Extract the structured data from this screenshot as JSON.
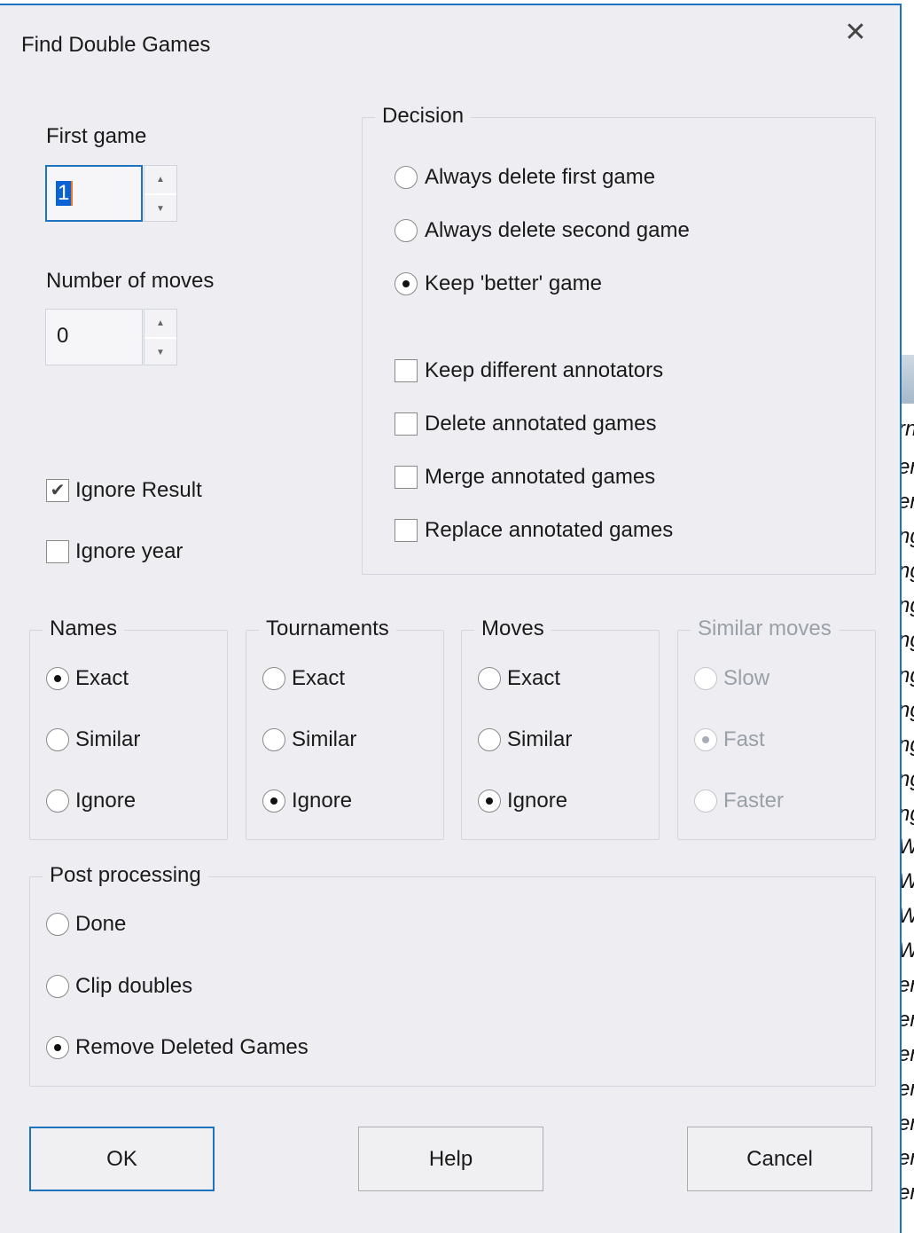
{
  "dialog": {
    "title": "Find Double Games",
    "close_icon": "close-icon"
  },
  "first_game": {
    "label": "First game",
    "value": "1"
  },
  "number_of_moves": {
    "label": "Number of moves",
    "value": "0"
  },
  "options": [
    {
      "label": "Ignore Result",
      "checked": true
    },
    {
      "label": "Ignore year",
      "checked": false
    }
  ],
  "decision": {
    "title": "Decision",
    "radios": [
      {
        "label": "Always delete first game",
        "selected": false
      },
      {
        "label": "Always delete second game",
        "selected": false
      },
      {
        "label": "Keep 'better' game",
        "selected": true
      }
    ],
    "checkboxes": [
      {
        "label": "Keep different annotators",
        "checked": false
      },
      {
        "label": "Delete annotated games",
        "checked": false
      },
      {
        "label": "Merge annotated games",
        "checked": false
      },
      {
        "label": "Replace annotated games",
        "checked": false
      }
    ]
  },
  "groups": [
    {
      "title": "Names",
      "enabled": true,
      "options": [
        {
          "label": "Exact",
          "selected": true
        },
        {
          "label": "Similar",
          "selected": false
        },
        {
          "label": "Ignore",
          "selected": false
        }
      ]
    },
    {
      "title": "Tournaments",
      "enabled": true,
      "options": [
        {
          "label": "Exact",
          "selected": false
        },
        {
          "label": "Similar",
          "selected": false
        },
        {
          "label": "Ignore",
          "selected": true
        }
      ]
    },
    {
      "title": "Moves",
      "enabled": true,
      "options": [
        {
          "label": "Exact",
          "selected": false
        },
        {
          "label": "Similar",
          "selected": false
        },
        {
          "label": "Ignore",
          "selected": true
        }
      ]
    },
    {
      "title": "Similar moves",
      "enabled": false,
      "options": [
        {
          "label": "Slow",
          "selected": false
        },
        {
          "label": "Fast",
          "selected": true
        },
        {
          "label": "Faster",
          "selected": false
        }
      ]
    }
  ],
  "post_processing": {
    "title": "Post processing",
    "options": [
      {
        "label": "Done",
        "selected": false
      },
      {
        "label": "Clip doubles",
        "selected": false
      },
      {
        "label": "Remove Deleted Games",
        "selected": true
      }
    ]
  },
  "buttons": {
    "ok": "OK",
    "help": "Help",
    "cancel": "Cancel"
  },
  "background_fragments": [
    "rn",
    "er",
    "er",
    "ng",
    "ng",
    "ng",
    "ng",
    "ng",
    "ng",
    "ng",
    "ng",
    "ng",
    "W",
    "W",
    "W",
    "W",
    "er",
    "er",
    "er",
    "er",
    "er",
    "er",
    "er"
  ],
  "colors": {
    "accent": "#1e73be",
    "dialog_bg": "#eeeef2",
    "selection": "#0a63d6"
  }
}
